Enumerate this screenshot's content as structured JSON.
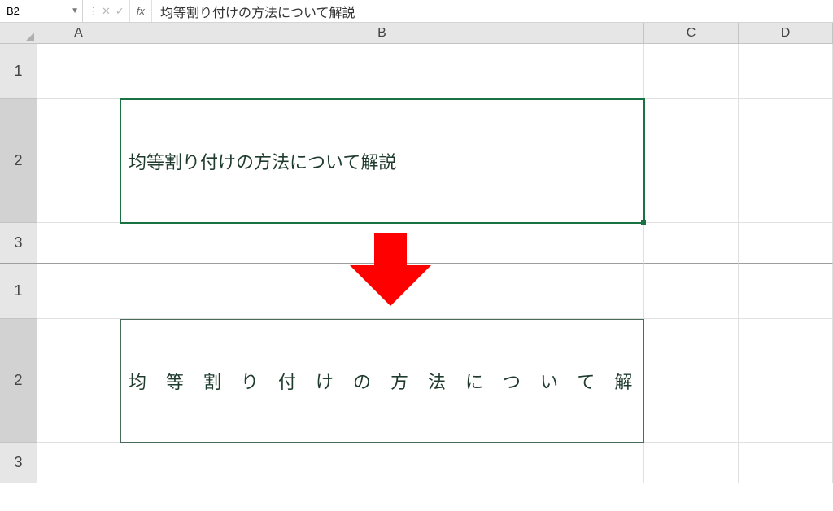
{
  "formulaBar": {
    "nameBox": "B2",
    "cancel": "✕",
    "confirm": "✓",
    "fxLabel": "fx",
    "formulaValue": "均等割り付けの方法について解説"
  },
  "columns": {
    "A": "A",
    "B": "B",
    "C": "C",
    "D": "D"
  },
  "rowsTop": {
    "r1": "1",
    "r2": "2",
    "r3": "3"
  },
  "rowsBottom": {
    "r1": "1",
    "r2": "2",
    "r3": "3"
  },
  "cellTextBefore": "均等割り付けの方法について解説",
  "cellTextAfter": "均等割り付けの方法について解説"
}
